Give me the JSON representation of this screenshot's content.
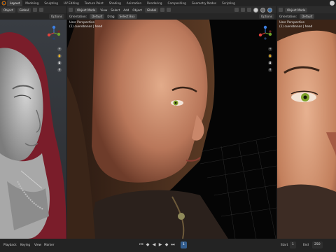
{
  "top_tabs": [
    "Layout",
    "Modeling",
    "Sculpting",
    "UV Editing",
    "Texture Paint",
    "Shading",
    "Animation",
    "Rendering",
    "Compositing",
    "Geometry Nodes",
    "Scripting"
  ],
  "viewport_left": {
    "header": {
      "object": "Object",
      "transform": "Global"
    },
    "subheader": {
      "options": "Options"
    }
  },
  "viewport_center": {
    "header": {
      "mode": "Object Mode",
      "menus": [
        "View",
        "Select",
        "Add",
        "Object"
      ],
      "transform": "Global"
    },
    "subheader": {
      "orientation": "Orientation:",
      "default": "Default",
      "drag": "Drag",
      "select_box": "Select Box",
      "options": "Options"
    },
    "overlay": {
      "line1": "User Perspective",
      "line2": "(1) cuerobanas | head"
    }
  },
  "viewport_right": {
    "header": {
      "mode": "Object Mode"
    },
    "subheader": {
      "orientation": "Orientation:",
      "default": "Default"
    },
    "overlay": {
      "line1": "User Perspective",
      "line2": "(1) cuerobanas | head"
    }
  },
  "timeline": {
    "playback": "Playback",
    "keying": "Keying",
    "view": "View",
    "marker": "Marker",
    "current_frame": "1",
    "start_label": "Start",
    "start": "1",
    "end_label": "End",
    "end": "250"
  },
  "colors": {
    "accent": "#345e8f",
    "x_axis": "#e0413c",
    "y_axis": "#6ea32b",
    "z_axis": "#3d7fe0"
  },
  "icons": [
    "blender-logo-icon",
    "gizmo-icon",
    "zoom-icon",
    "hand-icon",
    "camera-icon",
    "grid-icon",
    "play-icon",
    "jump-start-icon",
    "jump-end-icon",
    "user-avatar-icon"
  ]
}
